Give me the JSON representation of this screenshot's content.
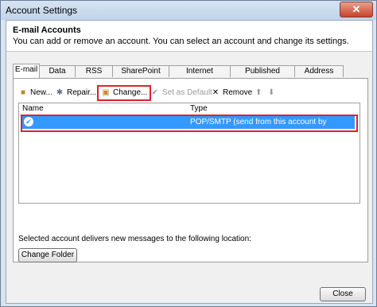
{
  "window": {
    "title": "Account Settings",
    "close_glyph": "✕"
  },
  "header": {
    "title": "E-mail Accounts",
    "subtitle": "You can add or remove an account. You can select an account and change its settings."
  },
  "tabs": [
    "E-mail",
    "Data Files",
    "RSS Feeds",
    "SharePoint Lists",
    "Internet Calendars",
    "Published Calendars",
    "Address Books"
  ],
  "toolbar": {
    "new": "New...",
    "repair": "Repair...",
    "change": "Change...",
    "set_default": "Set as Default",
    "remove": "Remove",
    "up_glyph": "⬆",
    "down_glyph": "⬇"
  },
  "accounts_table": {
    "columns": [
      "Name",
      "Type"
    ],
    "rows": [
      {
        "name": "",
        "type": "POP/SMTP (send from this account by default)",
        "selected": true
      }
    ]
  },
  "delivery": {
    "label": "Selected account delivers new messages to the following location:",
    "change_folder": "Change Folder"
  },
  "footer": {
    "close": "Close"
  },
  "colors": {
    "selection": "#3399ff",
    "highlight": "#e0202a"
  }
}
